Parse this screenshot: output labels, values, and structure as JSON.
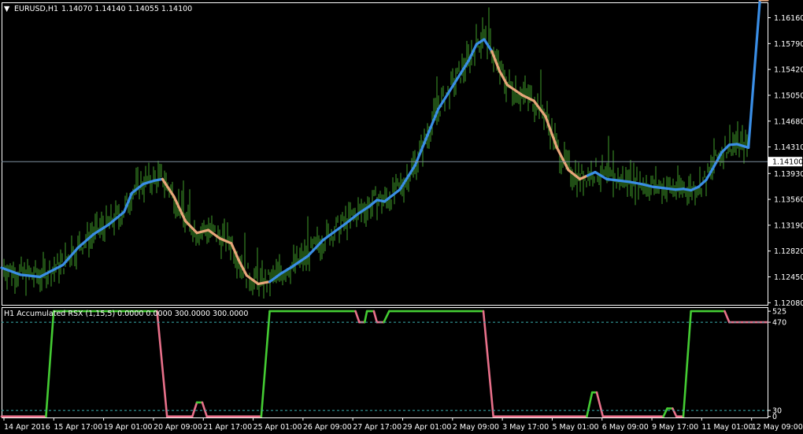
{
  "header": {
    "symbol": "EURUSD,H1",
    "ohlc": "1.14070 1.14140 1.14055 1.14100",
    "menu_glyph": "▼"
  },
  "indicator": {
    "label": "H1 Accumulated RSX (1,15,5) 0.0000 0.0000 300.0000 300.0000"
  },
  "colors": {
    "background": "#000000",
    "frame": "#ffffff",
    "bars": "#3f9b2a",
    "ma_up": "#3a8ee6",
    "ma_down": "#e8a67a",
    "rsx_up": "#44cc33",
    "rsx_down": "#e8708a",
    "level_line": "#3ab0b0",
    "price_line": "#7f8fa0"
  },
  "chart_data": [
    {
      "type": "line",
      "name": "price-panel",
      "current_price": 1.141,
      "current_price_label": "1.14100",
      "y_ticks": [
        "1.16160",
        "1.15790",
        "1.15420",
        "1.15050",
        "1.14680",
        "1.14310",
        "1.13930",
        "1.13560",
        "1.13190",
        "1.12820",
        "1.12450",
        "1.12080"
      ],
      "y_tick_values": [
        1.1616,
        1.1579,
        1.1542,
        1.1505,
        1.1468,
        1.1431,
        1.1393,
        1.1356,
        1.1319,
        1.1282,
        1.1245,
        1.1208
      ],
      "ylim": [
        1.1205,
        1.1638
      ],
      "x_ticks": [
        "14 Apr 2016",
        "15 Apr 17:00",
        "19 Apr 01:00",
        "20 Apr 09:00",
        "21 Apr 17:00",
        "25 Apr 01:00",
        "26 Apr 09:00",
        "27 Apr 17:00",
        "29 Apr 01:00",
        "2 May 09:00",
        "3 May 17:00",
        "5 May 01:00",
        "6 May 09:00",
        "9 May 17:00",
        "11 May 01:00",
        "12 May 09:00"
      ],
      "x_range": [
        0,
        100
      ],
      "smooth_line": {
        "x": [
          0,
          2.5,
          5,
          8,
          10,
          12,
          14,
          16,
          17,
          18.5,
          20,
          21,
          22.5,
          24,
          25.5,
          27,
          28.5,
          30,
          31,
          32,
          33.5,
          35,
          36.5,
          38,
          40,
          42,
          43.5,
          45,
          46.5,
          48,
          49,
          50,
          52,
          54,
          55.5,
          57,
          59,
          61,
          62,
          63,
          64,
          65,
          66,
          68,
          69.5,
          71,
          72.5,
          74,
          75.5,
          76.5,
          77.5,
          79,
          80.5,
          82,
          83.5,
          85,
          86.5,
          88,
          89,
          90,
          91,
          92,
          93,
          94,
          95,
          96,
          97.5,
          99,
          100
        ],
        "y": [
          1.1258,
          1.1248,
          1.1245,
          1.1262,
          1.1287,
          1.1306,
          1.132,
          1.1338,
          1.1365,
          1.1378,
          1.1383,
          1.1385,
          1.136,
          1.1325,
          1.1308,
          1.1312,
          1.13,
          1.1293,
          1.1268,
          1.1247,
          1.1235,
          1.1238,
          1.125,
          1.126,
          1.1275,
          1.1298,
          1.131,
          1.1322,
          1.1335,
          1.1346,
          1.1355,
          1.1353,
          1.137,
          1.1405,
          1.1445,
          1.1485,
          1.152,
          1.1555,
          1.1578,
          1.1585,
          1.1568,
          1.154,
          1.152,
          1.1505,
          1.1497,
          1.1475,
          1.143,
          1.1398,
          1.1385,
          1.139,
          1.1395,
          1.1385,
          1.1383,
          1.1381,
          1.1378,
          1.1374,
          1.1372,
          1.137,
          1.1371,
          1.1369,
          1.1374,
          1.1384,
          1.1403,
          1.1423,
          1.1434,
          1.1435,
          1.143
        ],
        "trend": [
          "up",
          "up",
          "up",
          "up",
          "up",
          "up",
          "up",
          "up",
          "up",
          "up",
          "up",
          "down",
          "down",
          "down",
          "down",
          "down",
          "down",
          "down",
          "down",
          "down",
          "down",
          "up",
          "up",
          "up",
          "up",
          "up",
          "up",
          "up",
          "up",
          "up",
          "up",
          "up",
          "up",
          "up",
          "up",
          "up",
          "up",
          "up",
          "up",
          "up",
          "down",
          "down",
          "down",
          "down",
          "down",
          "down",
          "down",
          "down",
          "down",
          "up",
          "up",
          "up",
          "up",
          "up",
          "up",
          "up",
          "up",
          "up",
          "up",
          "up",
          "up",
          "up",
          "up",
          "up",
          "up",
          "up",
          "up"
        ]
      },
      "bars_ohlc_note": "H1 bar chart (green) — values follow smooth line with noise"
    },
    {
      "type": "line",
      "name": "rsx-panel",
      "title": "H1 Accumulated RSX (1,15,5) 0.0000 0.0000 300.0000 300.0000",
      "y_ticks": [
        "525",
        "470",
        "30",
        "0"
      ],
      "y_tick_values": [
        525,
        470,
        30,
        0
      ],
      "levels": [
        470,
        30
      ],
      "ylim": [
        -5,
        545
      ],
      "x_range": [
        0,
        100
      ],
      "series": [
        {
          "x": [
            0,
            5.8,
            6.8,
            20.3,
            21.6,
            24.9,
            25.5,
            26.2,
            26.8,
            33.9,
            35.0,
            46.2,
            46.7,
            47.4,
            47.7,
            48.6,
            49.0,
            49.9,
            50.6,
            62.9,
            64.2,
            76.4,
            77.1,
            77.7,
            78.5,
            86.4,
            86.9,
            87.6,
            88.1,
            89.0,
            90.0,
            94.4,
            95.0,
            100
          ],
          "y": [
            0,
            0,
            525,
            525,
            0,
            0,
            70,
            70,
            0,
            0,
            525,
            525,
            470,
            470,
            525,
            525,
            470,
            470,
            525,
            525,
            0,
            0,
            120,
            120,
            0,
            0,
            40,
            40,
            0,
            0,
            525,
            525,
            470,
            470
          ],
          "trend": [
            "down",
            "up",
            "up",
            "down",
            "down",
            "down",
            "up",
            "down",
            "down",
            "up",
            "up",
            "down",
            "down",
            "up",
            "up",
            "down",
            "down",
            "up",
            "up",
            "down",
            "down",
            "up",
            "up",
            "down",
            "down",
            "up",
            "up",
            "down",
            "down",
            "up",
            "up",
            "down",
            "down",
            "down"
          ]
        }
      ]
    }
  ]
}
